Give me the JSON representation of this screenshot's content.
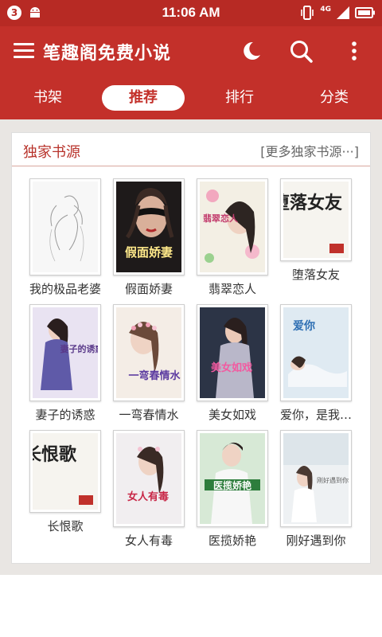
{
  "status_bar": {
    "badge": "3",
    "time": "11:06 AM",
    "network": "4G"
  },
  "app_bar": {
    "title": "笔趣阁免费小说",
    "icons": [
      "menu-icon",
      "moon-icon",
      "search-icon",
      "more-vert-icon"
    ]
  },
  "tabs": [
    {
      "label": "书架",
      "active": false
    },
    {
      "label": "推荐",
      "active": true
    },
    {
      "label": "排行",
      "active": false
    },
    {
      "label": "分类",
      "active": false
    }
  ],
  "section": {
    "title": "独家书源",
    "more_label": "[更多独家书源···]"
  },
  "books": [
    {
      "title": "我的极品老婆",
      "cover_text": ""
    },
    {
      "title": "假面娇妻",
      "cover_text": "假面娇妻"
    },
    {
      "title": "翡翠恋人",
      "cover_text": "翡翠恋人"
    },
    {
      "title": "堕落女友",
      "cover_text": "堕落女友"
    },
    {
      "title": "妻子的诱惑",
      "cover_text": "妻子的诱惑"
    },
    {
      "title": "一弯春情水",
      "cover_text": "一弯春情水"
    },
    {
      "title": "美女如戏",
      "cover_text": "美女如戏"
    },
    {
      "title": "爱你，是我…",
      "cover_text": "爱你"
    },
    {
      "title": "长恨歌",
      "cover_text": "长恨歌"
    },
    {
      "title": "女人有毒",
      "cover_text": "女人有毒"
    },
    {
      "title": "医揽娇艳",
      "cover_text": "医揽娇艳"
    },
    {
      "title": "刚好遇到你",
      "cover_text": "刚好遇到你"
    }
  ],
  "colors": {
    "primary": "#c3302a",
    "status_bar": "#b72a24",
    "section_title": "#b8332b"
  }
}
